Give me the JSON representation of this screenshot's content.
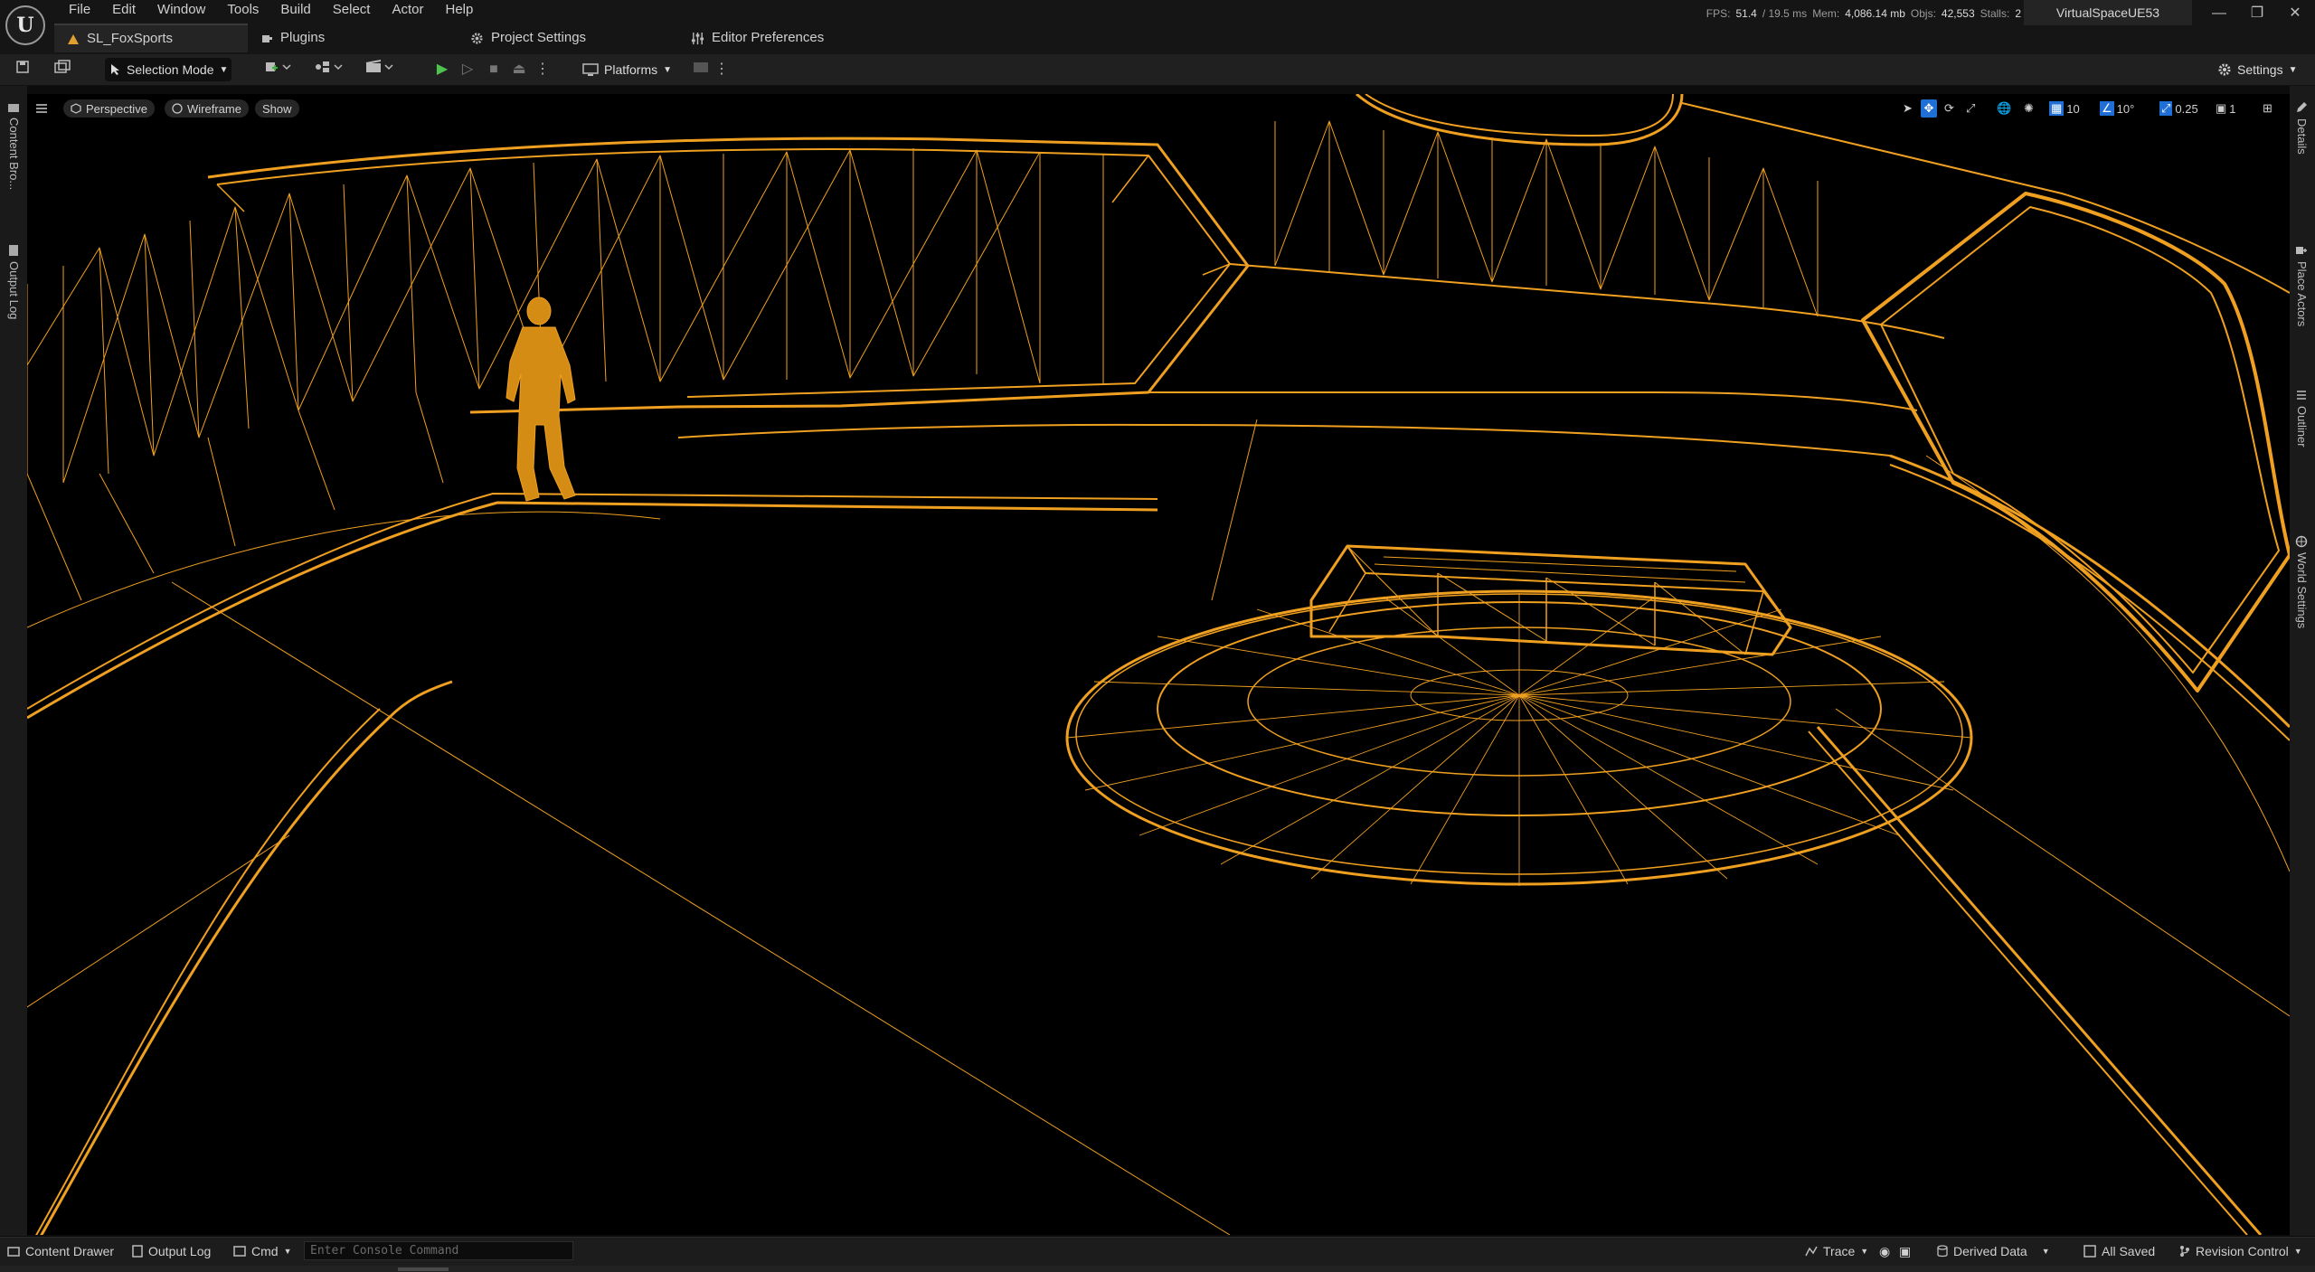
{
  "app": {
    "logo_letter": "U",
    "menus": [
      "File",
      "Edit",
      "Window",
      "Tools",
      "Build",
      "Select",
      "Actor",
      "Help"
    ],
    "tabs": [
      {
        "label": "SL_FoxSports",
        "icon": "level-icon"
      },
      {
        "label": "Plugins",
        "icon": "plugin-icon"
      },
      {
        "label": "Project Settings",
        "icon": "gear-icon"
      },
      {
        "label": "Editor Preferences",
        "icon": "sliders-icon"
      }
    ],
    "stats": {
      "fps_label": "FPS:",
      "fps": "51.4",
      "ms": "/ 19.5 ms",
      "mem_label": "Mem:",
      "mem": "4,086.14 mb",
      "objs_label": "Objs:",
      "objs": "42,553",
      "stalls_label": "Stalls:",
      "stalls": "2"
    },
    "project_name": "VirtualSpaceUE53"
  },
  "toolbar": {
    "selection_mode": "Selection Mode",
    "platforms": "Platforms",
    "settings": "Settings"
  },
  "left_panel": {
    "content_browser": "Content Bro...",
    "output_log": "Output Log"
  },
  "right_panel": {
    "details": "Details",
    "place_actors": "Place Actors",
    "outliner": "Outliner",
    "world_settings": "World Settings"
  },
  "viewport": {
    "perspective": "Perspective",
    "wireframe": "Wireframe",
    "show": "Show",
    "grid_snap": "10",
    "rotation_snap": "10°",
    "scale_snap": "0.25",
    "camera_speed": "1",
    "wire_color": "#f0a020"
  },
  "statusbar": {
    "content_drawer": "Content Drawer",
    "output_log": "Output Log",
    "cmd": "Cmd",
    "console_placeholder": "Enter Console Command",
    "trace": "Trace",
    "derived_data": "Derived Data",
    "all_saved": "All Saved",
    "revision_control": "Revision Control"
  }
}
